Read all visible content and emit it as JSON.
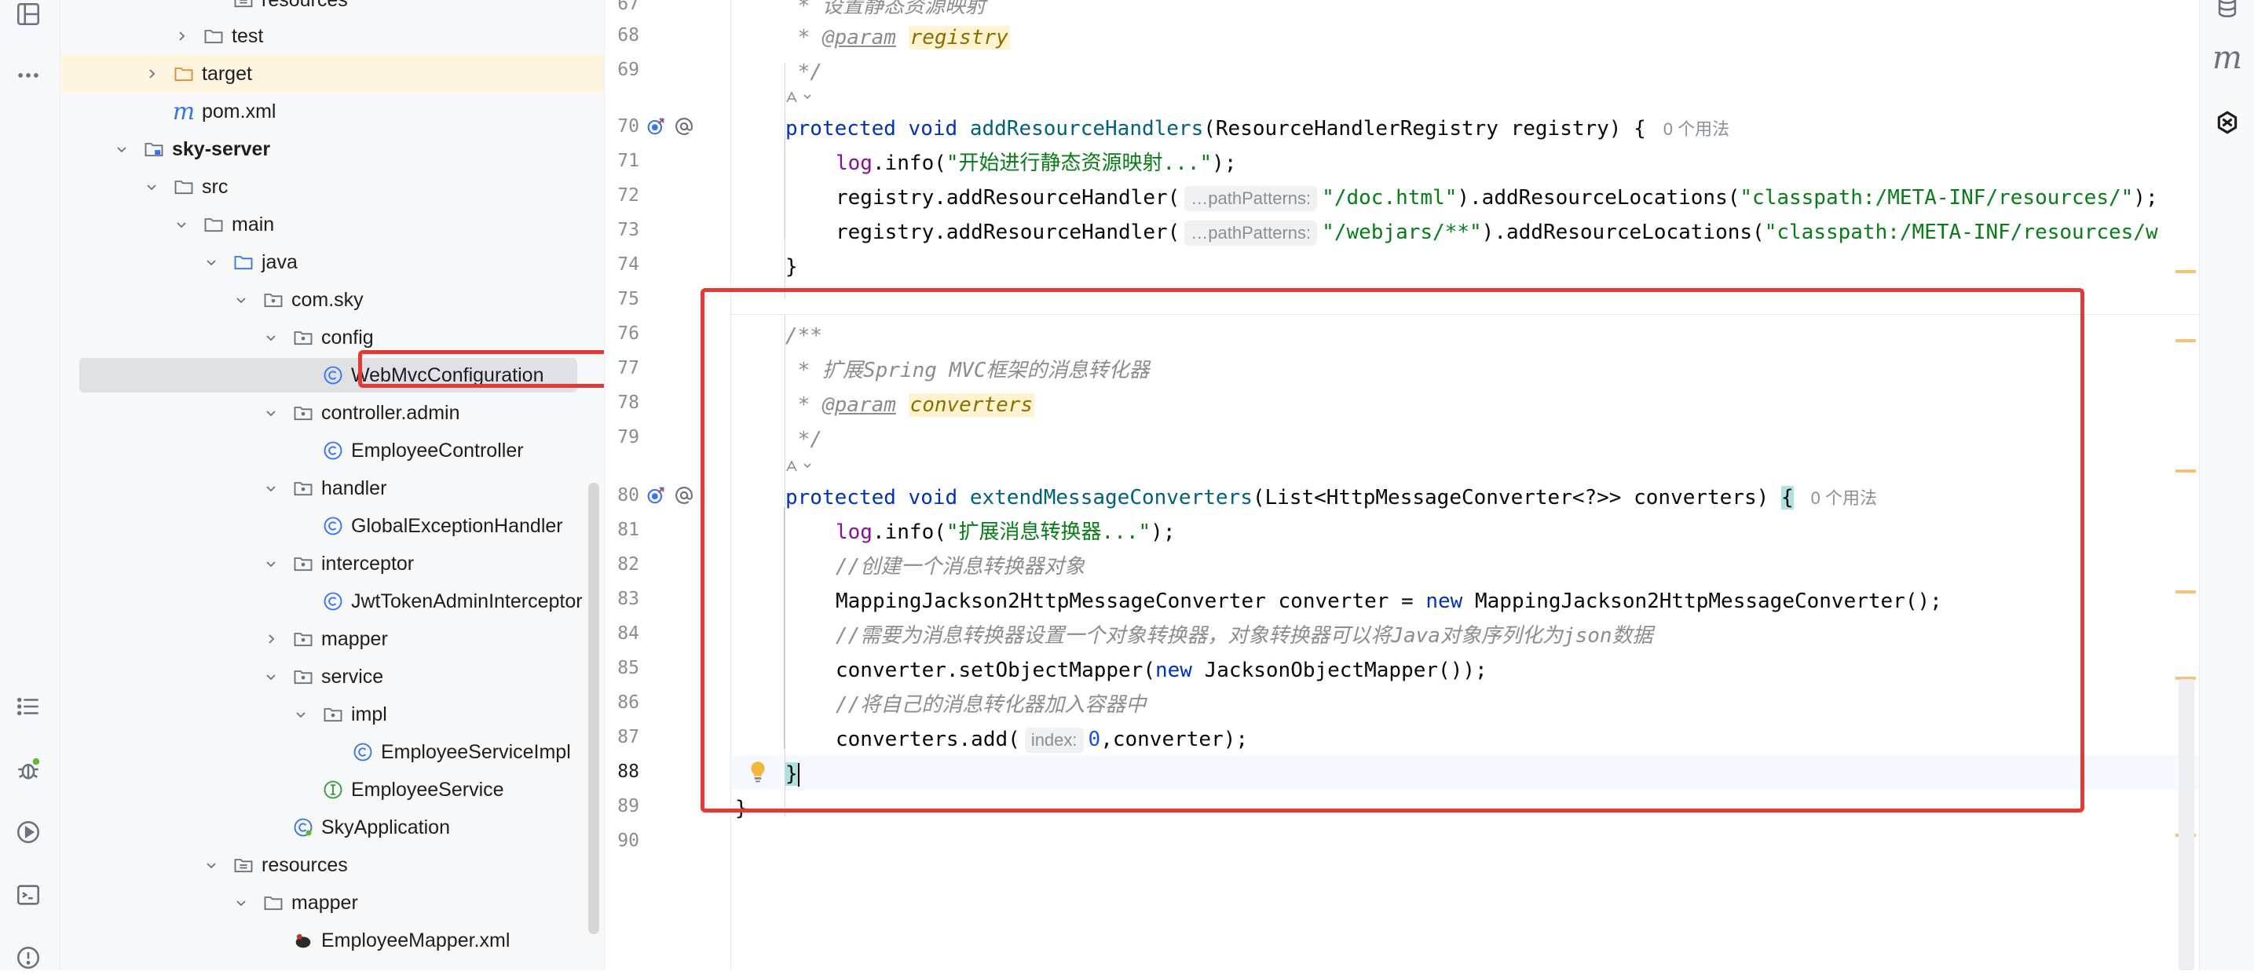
{
  "tree": {
    "rows": [
      {
        "label": "resources",
        "icon": "resources-folder-icon",
        "bold": false
      },
      {
        "label": "test",
        "icon": "folder-icon",
        "bold": false
      },
      {
        "label": "target",
        "icon": "folder-icon",
        "bold": false
      },
      {
        "label": "pom.xml",
        "icon": "maven-icon",
        "bold": false
      },
      {
        "label": "sky-server",
        "icon": "module-folder-icon",
        "bold": true
      },
      {
        "label": "src",
        "icon": "folder-icon",
        "bold": false
      },
      {
        "label": "main",
        "icon": "folder-icon",
        "bold": false
      },
      {
        "label": "java",
        "icon": "source-folder-icon",
        "bold": false
      },
      {
        "label": "com.sky",
        "icon": "package-icon",
        "bold": false
      },
      {
        "label": "config",
        "icon": "package-icon",
        "bold": false
      },
      {
        "label": "WebMvcConfiguration",
        "icon": "class-icon",
        "bold": false
      },
      {
        "label": "controller.admin",
        "icon": "package-icon",
        "bold": false
      },
      {
        "label": "EmployeeController",
        "icon": "class-icon",
        "bold": false
      },
      {
        "label": "handler",
        "icon": "package-icon",
        "bold": false
      },
      {
        "label": "GlobalExceptionHandler",
        "icon": "class-icon",
        "bold": false
      },
      {
        "label": "interceptor",
        "icon": "package-icon",
        "bold": false
      },
      {
        "label": "JwtTokenAdminInterceptor",
        "icon": "class-icon",
        "bold": false
      },
      {
        "label": "mapper",
        "icon": "package-icon",
        "bold": false
      },
      {
        "label": "service",
        "icon": "package-icon",
        "bold": false
      },
      {
        "label": "impl",
        "icon": "package-icon",
        "bold": false
      },
      {
        "label": "EmployeeServiceImpl",
        "icon": "class-icon",
        "bold": false
      },
      {
        "label": "EmployeeService",
        "icon": "interface-icon",
        "bold": false
      },
      {
        "label": "SkyApplication",
        "icon": "spring-class-icon",
        "bold": false
      },
      {
        "label": "resources",
        "icon": "resources-folder-icon",
        "bold": false
      },
      {
        "label": "mapper",
        "icon": "folder-icon",
        "bold": false
      },
      {
        "label": "EmployeeMapper.xml",
        "icon": "mybatis-xml-icon",
        "bold": false
      }
    ]
  },
  "editor": {
    "line_numbers": [
      "67",
      "68",
      "69",
      "70",
      "71",
      "72",
      "73",
      "74",
      "75",
      "76",
      "77",
      "78",
      "79",
      "80",
      "81",
      "82",
      "83",
      "84",
      "85",
      "86",
      "87",
      "88",
      "89",
      "90"
    ],
    "current_line": "88",
    "code": {
      "l67": " * 设置静态资源映射",
      "l68_prefix": " * ",
      "l68_tag": "@param",
      "l68_param": "registry",
      "l69": " */",
      "l70_kw1": "protected",
      "l70_kw2": "void",
      "l70_fn": "addResourceHandlers",
      "l70_rest": "(ResourceHandlerRegistry registry) {",
      "l70_usage": "0 个用法",
      "l71_field": "log",
      "l71_mid": ".info(",
      "l71_str": "\"开始进行静态资源映射...\"",
      "l71_end": ");",
      "l72_start": "registry.addResourceHandler(",
      "l72_hint": "…pathPatterns:",
      "l72_str": "\"/doc.html\"",
      "l72_mid": ").addResourceLocations(",
      "l72_str2": "\"classpath:/META-INF/resources/\"",
      "l72_end": ");",
      "l73_start": "registry.addResourceHandler(",
      "l73_hint": "…pathPatterns:",
      "l73_str": "\"/webjars/**\"",
      "l73_mid": ").addResourceLocations(",
      "l73_str2": "\"classpath:/META-INF/resources/w",
      "l74": "}",
      "l76": "/**",
      "l77": " * 扩展Spring MVC框架的消息转化器",
      "l78_prefix": " * ",
      "l78_tag": "@param",
      "l78_param": "converters",
      "l79": " */",
      "l80_kw1": "protected",
      "l80_kw2": "void",
      "l80_fn": "extendMessageConverters",
      "l80_rest": "(List<HttpMessageConverter<?>> converters) ",
      "l80_brace": "{",
      "l80_usage": "0 个用法",
      "l81_field": "log",
      "l81_mid": ".info(",
      "l81_str": "\"扩展消息转换器...\"",
      "l81_end": ");",
      "l82": "//创建一个消息转换器对象",
      "l83_start": "MappingJackson2HttpMessageConverter converter = ",
      "l83_kw": "new",
      "l83_end": " MappingJackson2HttpMessageConverter();",
      "l84": "//需要为消息转换器设置一个对象转换器，对象转换器可以将Java对象序列化为json数据",
      "l85_start": "converter.setObjectMapper(",
      "l85_kw": "new",
      "l85_end": " JacksonObjectMapper());",
      "l86": "//将自己的消息转化器加入容器中",
      "l87_start": "converters.add(",
      "l87_hint": "index:",
      "l87_num": "0",
      "l87_end": ",converter);",
      "l88": "}",
      "l89": "}"
    }
  }
}
